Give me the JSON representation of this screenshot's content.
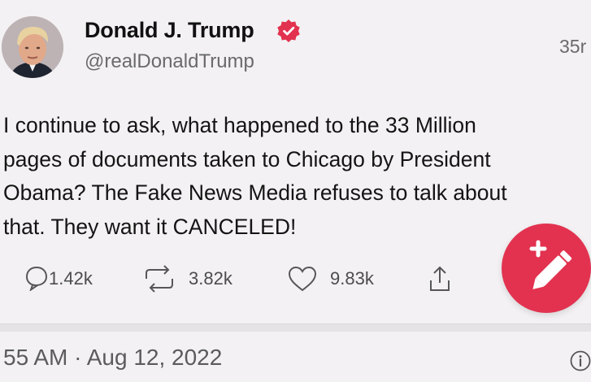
{
  "user": {
    "display_name": "Donald J. Trump",
    "handle": "@realDonaldTrump",
    "time_ago": "35r",
    "avatar_icon": "profile-photo",
    "verified_icon": "verified-badge-icon",
    "verified_color": "#e2324f"
  },
  "tweet": {
    "lines": [
      "I continue to ask, what happened to the 33 Million",
      "pages of documents taken to Chicago by President",
      "Obama? The Fake News Media refuses to talk about",
      "that. They want it CANCELED!"
    ]
  },
  "actions": {
    "reply": {
      "icon": "reply-icon",
      "count": "1.42k"
    },
    "retruth": {
      "icon": "repost-icon",
      "count": "3.82k"
    },
    "like": {
      "icon": "heart-icon",
      "count": "9.83k"
    },
    "share": {
      "icon": "share-icon"
    }
  },
  "compose": {
    "icon": "compose-pencil-icon",
    "color": "#e2324f"
  },
  "footer": {
    "timestamp": "55 AM · Aug 12, 2022",
    "info_icon": "info-icon"
  }
}
